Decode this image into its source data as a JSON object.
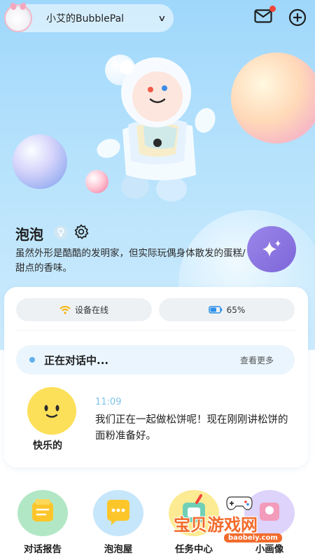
{
  "header": {
    "device_name": "小艾的BubblePal",
    "chevron_icon": "chevron-down-icon",
    "mail_icon": "mail-icon",
    "add_icon": "plus-circle-icon"
  },
  "character": {
    "name": "泡泡",
    "gender_icon": "female-icon",
    "settings_icon": "gear-icon",
    "description": "虽然外形是酷酷的发明家，但实际玩偶身体散发的蛋糕/甜点的香味。",
    "magic_icon": "sparkle-icon"
  },
  "status": {
    "online_label": "设备在线",
    "online_icon": "wifi-icon",
    "battery_label": "65%",
    "battery_level": 0.65,
    "battery_icon": "battery-icon"
  },
  "chat": {
    "status": "正在对话中...",
    "see_more": "查看更多",
    "mood_label": "快乐的",
    "time": "11:09",
    "message": "我们正在一起做松饼呢！现在刚刚讲松饼的面粉准备好。"
  },
  "nav": {
    "items": [
      {
        "label": "对话报告",
        "icon": "report-icon",
        "color": "#9fe0b8"
      },
      {
        "label": "泡泡屋",
        "icon": "chat-bubble-icon",
        "color": "#bde3fb"
      },
      {
        "label": "任务中心",
        "icon": "task-icon",
        "color": "#fde98c"
      },
      {
        "label": "小画像",
        "icon": "portrait-icon",
        "color": "#d7cdfb"
      }
    ]
  },
  "watermark": {
    "text": "宝贝游戏网",
    "url": "baobeiy.com"
  },
  "colors": {
    "accent_purple": "#7d66d9",
    "hero_blue": "#9fd7fb",
    "mood_yellow": "#fde05a",
    "time_blue": "#7fc3ec"
  }
}
